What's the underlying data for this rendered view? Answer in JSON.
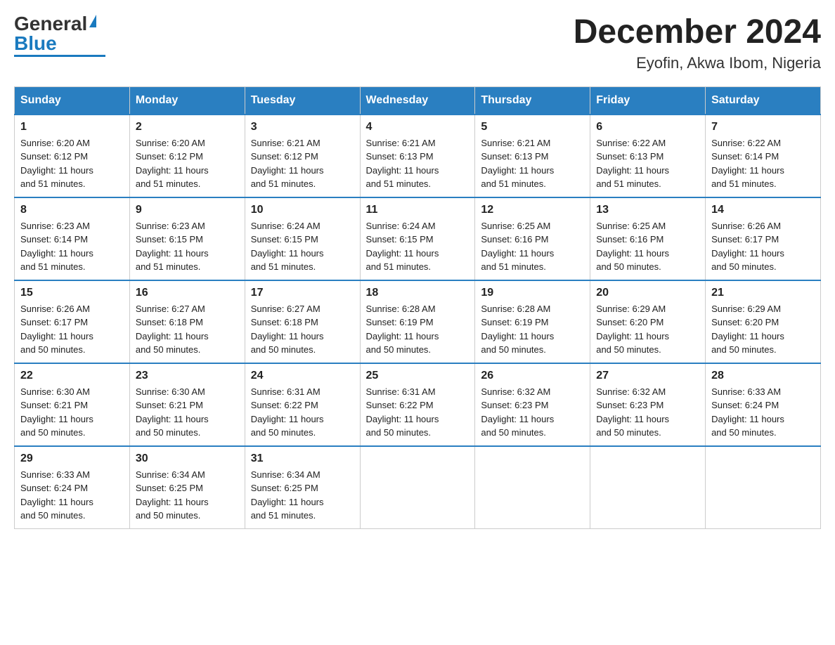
{
  "header": {
    "logo_general": "General",
    "logo_blue": "Blue",
    "month_title": "December 2024",
    "location": "Eyofin, Akwa Ibom, Nigeria"
  },
  "days_of_week": [
    "Sunday",
    "Monday",
    "Tuesday",
    "Wednesday",
    "Thursday",
    "Friday",
    "Saturday"
  ],
  "weeks": [
    [
      {
        "day": "1",
        "sunrise": "6:20 AM",
        "sunset": "6:12 PM",
        "daylight": "11 hours and 51 minutes."
      },
      {
        "day": "2",
        "sunrise": "6:20 AM",
        "sunset": "6:12 PM",
        "daylight": "11 hours and 51 minutes."
      },
      {
        "day": "3",
        "sunrise": "6:21 AM",
        "sunset": "6:12 PM",
        "daylight": "11 hours and 51 minutes."
      },
      {
        "day": "4",
        "sunrise": "6:21 AM",
        "sunset": "6:13 PM",
        "daylight": "11 hours and 51 minutes."
      },
      {
        "day": "5",
        "sunrise": "6:21 AM",
        "sunset": "6:13 PM",
        "daylight": "11 hours and 51 minutes."
      },
      {
        "day": "6",
        "sunrise": "6:22 AM",
        "sunset": "6:13 PM",
        "daylight": "11 hours and 51 minutes."
      },
      {
        "day": "7",
        "sunrise": "6:22 AM",
        "sunset": "6:14 PM",
        "daylight": "11 hours and 51 minutes."
      }
    ],
    [
      {
        "day": "8",
        "sunrise": "6:23 AM",
        "sunset": "6:14 PM",
        "daylight": "11 hours and 51 minutes."
      },
      {
        "day": "9",
        "sunrise": "6:23 AM",
        "sunset": "6:15 PM",
        "daylight": "11 hours and 51 minutes."
      },
      {
        "day": "10",
        "sunrise": "6:24 AM",
        "sunset": "6:15 PM",
        "daylight": "11 hours and 51 minutes."
      },
      {
        "day": "11",
        "sunrise": "6:24 AM",
        "sunset": "6:15 PM",
        "daylight": "11 hours and 51 minutes."
      },
      {
        "day": "12",
        "sunrise": "6:25 AM",
        "sunset": "6:16 PM",
        "daylight": "11 hours and 51 minutes."
      },
      {
        "day": "13",
        "sunrise": "6:25 AM",
        "sunset": "6:16 PM",
        "daylight": "11 hours and 50 minutes."
      },
      {
        "day": "14",
        "sunrise": "6:26 AM",
        "sunset": "6:17 PM",
        "daylight": "11 hours and 50 minutes."
      }
    ],
    [
      {
        "day": "15",
        "sunrise": "6:26 AM",
        "sunset": "6:17 PM",
        "daylight": "11 hours and 50 minutes."
      },
      {
        "day": "16",
        "sunrise": "6:27 AM",
        "sunset": "6:18 PM",
        "daylight": "11 hours and 50 minutes."
      },
      {
        "day": "17",
        "sunrise": "6:27 AM",
        "sunset": "6:18 PM",
        "daylight": "11 hours and 50 minutes."
      },
      {
        "day": "18",
        "sunrise": "6:28 AM",
        "sunset": "6:19 PM",
        "daylight": "11 hours and 50 minutes."
      },
      {
        "day": "19",
        "sunrise": "6:28 AM",
        "sunset": "6:19 PM",
        "daylight": "11 hours and 50 minutes."
      },
      {
        "day": "20",
        "sunrise": "6:29 AM",
        "sunset": "6:20 PM",
        "daylight": "11 hours and 50 minutes."
      },
      {
        "day": "21",
        "sunrise": "6:29 AM",
        "sunset": "6:20 PM",
        "daylight": "11 hours and 50 minutes."
      }
    ],
    [
      {
        "day": "22",
        "sunrise": "6:30 AM",
        "sunset": "6:21 PM",
        "daylight": "11 hours and 50 minutes."
      },
      {
        "day": "23",
        "sunrise": "6:30 AM",
        "sunset": "6:21 PM",
        "daylight": "11 hours and 50 minutes."
      },
      {
        "day": "24",
        "sunrise": "6:31 AM",
        "sunset": "6:22 PM",
        "daylight": "11 hours and 50 minutes."
      },
      {
        "day": "25",
        "sunrise": "6:31 AM",
        "sunset": "6:22 PM",
        "daylight": "11 hours and 50 minutes."
      },
      {
        "day": "26",
        "sunrise": "6:32 AM",
        "sunset": "6:23 PM",
        "daylight": "11 hours and 50 minutes."
      },
      {
        "day": "27",
        "sunrise": "6:32 AM",
        "sunset": "6:23 PM",
        "daylight": "11 hours and 50 minutes."
      },
      {
        "day": "28",
        "sunrise": "6:33 AM",
        "sunset": "6:24 PM",
        "daylight": "11 hours and 50 minutes."
      }
    ],
    [
      {
        "day": "29",
        "sunrise": "6:33 AM",
        "sunset": "6:24 PM",
        "daylight": "11 hours and 50 minutes."
      },
      {
        "day": "30",
        "sunrise": "6:34 AM",
        "sunset": "6:25 PM",
        "daylight": "11 hours and 50 minutes."
      },
      {
        "day": "31",
        "sunrise": "6:34 AM",
        "sunset": "6:25 PM",
        "daylight": "11 hours and 51 minutes."
      },
      null,
      null,
      null,
      null
    ]
  ],
  "labels": {
    "sunrise": "Sunrise:",
    "sunset": "Sunset:",
    "daylight": "Daylight:"
  }
}
